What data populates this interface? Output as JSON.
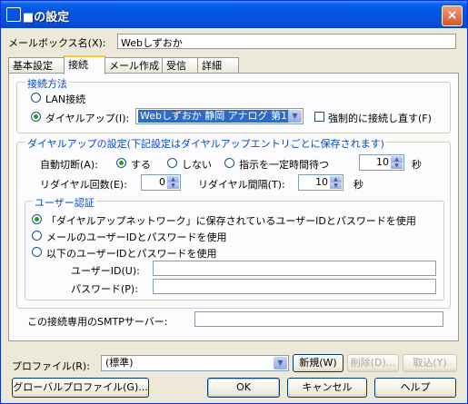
{
  "window": {
    "title": "■の設定",
    "close_icon": "×"
  },
  "mailbox": {
    "label": "メールボックス名(X):",
    "value": "Webしずおか"
  },
  "tabs": [
    "基本設定",
    "接続",
    "メール作成",
    "受信",
    "詳細"
  ],
  "connection_method": {
    "title": "接続方法",
    "lan_label": "LAN接続",
    "dialup_label": "ダイヤルアップ(I):",
    "dialup_value": "Webしずおか 静岡 アナログ 第1",
    "force_reconnect_label": "強制的に接続し直す(F)"
  },
  "dialup_settings": {
    "title": "ダイヤルアップの設定(下記設定はダイヤルアップエントリごとに保存されます)",
    "auto_disconnect_label": "自動切断(A):",
    "opt_yes": "する",
    "opt_no": "しない",
    "opt_wait": "指示を一定時間待つ",
    "wait_value": "10",
    "seconds_unit": "秒",
    "redial_count_label": "リダイヤル回数(E):",
    "redial_count_value": "0",
    "redial_interval_label": "リダイヤル間隔(T):",
    "redial_interval_value": "10",
    "seconds_unit2": "秒"
  },
  "user_auth": {
    "title": "ユーザー認証",
    "opt1": "「ダイヤルアップネットワーク」に保存されているユーザーIDとパスワードを使用",
    "opt2": "メールのユーザーIDとパスワードを使用",
    "opt3": "以下のユーザーIDとパスワードを使用",
    "userid_label": "ユーザーID(U):",
    "userid_value": "",
    "password_label": "パスワード(P):",
    "password_value": ""
  },
  "smtp": {
    "label": "この接続専用のSMTPサーバー:",
    "value": ""
  },
  "profile": {
    "label": "プロファイル(R):",
    "value": "(標準)",
    "new_button": "新規(W)",
    "delete_button": "削除(D)...",
    "import_button": "取込(Y)"
  },
  "footer": {
    "global_profile_button": "グローバルプロファイル(G)...",
    "ok_button": "OK",
    "cancel_button": "キャンセル",
    "help_button": "ヘルプ"
  },
  "colors": {
    "titlebar": "#0054e3",
    "selected": "#316ac5",
    "radio_dot": "#21a121",
    "group_title": "#0046d5"
  }
}
